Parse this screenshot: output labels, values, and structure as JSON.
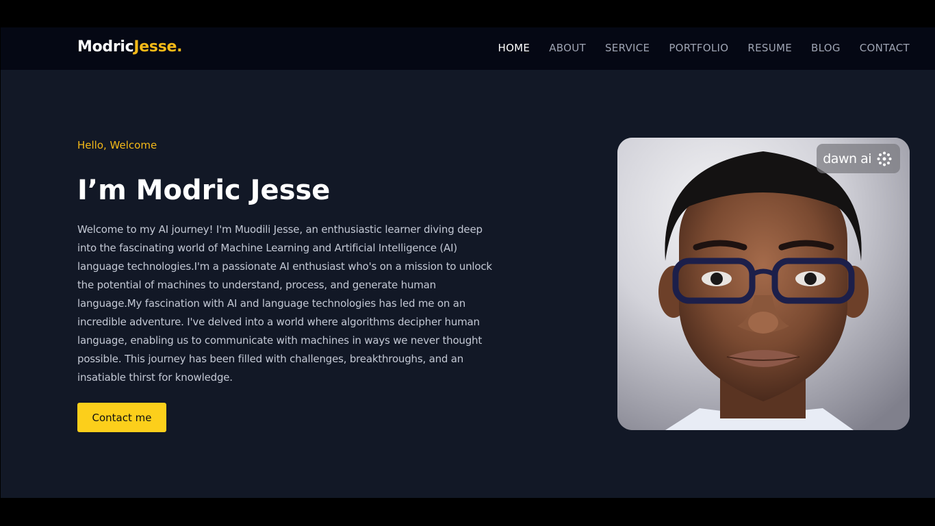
{
  "brand": {
    "name_part1": "Modric",
    "name_part2": "Jesse.",
    "accent_color": "#f4b918"
  },
  "nav": {
    "items": [
      {
        "label": "HOME",
        "active": true
      },
      {
        "label": "ABOUT",
        "active": false
      },
      {
        "label": "SERVICE",
        "active": false
      },
      {
        "label": "PORTFOLIO",
        "active": false
      },
      {
        "label": "RESUME",
        "active": false
      },
      {
        "label": "BLOG",
        "active": false
      },
      {
        "label": "CONTACT",
        "active": false
      }
    ]
  },
  "hero": {
    "eyebrow": "Hello, Welcome",
    "headline": "I’m Modric Jesse",
    "bio": "Welcome to my AI journey! I'm Muodili Jesse, an enthusiastic learner diving deep into the fascinating world of Machine Learning and Artificial Intelligence (AI) language technologies.I'm a passionate AI enthusiast who's on a mission to unlock the potential of machines to understand, process, and generate human language.My fascination with AI and language technologies has led me on an incredible adventure. I've delved into a world where algorithms decipher human language, enabling us to communicate with machines in ways we never thought possible. This journey has been filled with challenges, breakthroughs, and an insatiable thirst for knowledge.",
    "cta_label": "Contact me",
    "cta_color": "#fccf1b"
  },
  "portrait": {
    "watermark_text": "dawn ai",
    "watermark_icon": "sparkle-ring-icon"
  },
  "colors": {
    "page_bg": "#121826",
    "nav_bg": "#050814",
    "nav_inactive": "#9ea4b3",
    "body_text": "#c3c8d4"
  }
}
